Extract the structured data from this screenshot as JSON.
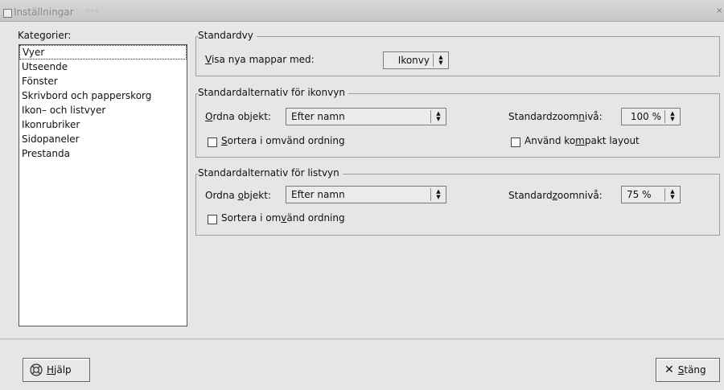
{
  "window": {
    "title": "Inställningar",
    "icon": "window-menu-icon",
    "close_icon": "close-icon"
  },
  "categories": {
    "label": "Kategorier:",
    "items": [
      {
        "label": "Vyer",
        "selected": true
      },
      {
        "label": "Utseende"
      },
      {
        "label": "Fönster"
      },
      {
        "label": "Skrivbord och papperskorg"
      },
      {
        "label": "Ikon– och listvyer"
      },
      {
        "label": "Ikonrubriker"
      },
      {
        "label": "Sidopaneler"
      },
      {
        "label": "Prestanda"
      }
    ]
  },
  "standardvy": {
    "title": "Standardvy",
    "show_label_u": "V",
    "show_label_rest": "isa nya mappar med:",
    "show_value": "Ikonvy"
  },
  "iconview": {
    "title": "Standardalternativ för ikonvyn",
    "arrange_label_u": "O",
    "arrange_label_rest": "rdna objekt:",
    "arrange_value": "Efter namn",
    "zoom_label_pre": "Standardzoom",
    "zoom_label_u": "n",
    "zoom_label_post": "ivå:",
    "zoom_value": "100 %",
    "reverse_u": "S",
    "reverse_rest": "ortera i omvänd ordning",
    "reverse_checked": false,
    "compact_pre": "Använd ko",
    "compact_u": "m",
    "compact_post": "pakt layout",
    "compact_checked": false
  },
  "listview": {
    "title": "Standardalternativ för listvyn",
    "arrange_label_pre": "Ordna ",
    "arrange_label_u": "o",
    "arrange_label_post": "bjekt:",
    "arrange_value": "Efter namn",
    "zoom_label_pre": "Standard",
    "zoom_label_u": "z",
    "zoom_label_post": "oomnivå:",
    "zoom_value": "75 %",
    "reverse_pre": "Sortera i om",
    "reverse_u": "v",
    "reverse_post": "änd ordning",
    "reverse_checked": false
  },
  "buttons": {
    "help_u": "H",
    "help_rest": "jälp",
    "help_icon": "help-lifebuoy-icon",
    "close_icon": "close-x-icon",
    "close_u": "S",
    "close_rest": "täng"
  }
}
